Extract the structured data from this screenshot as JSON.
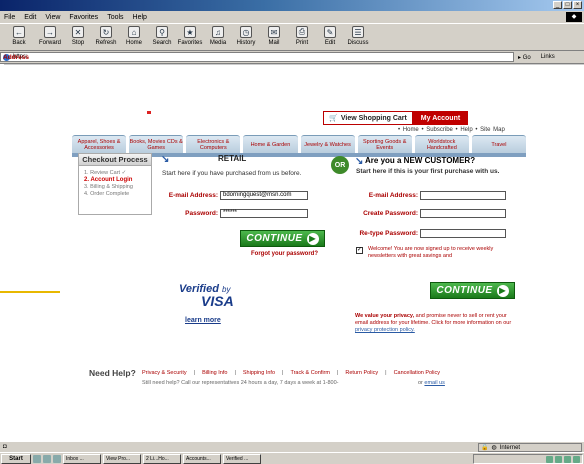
{
  "browser": {
    "menu": [
      "File",
      "Edit",
      "View",
      "Favorites",
      "Tools",
      "Help"
    ],
    "toolbar": [
      "Back",
      "Forward",
      "Stop",
      "Refresh",
      "Home",
      "Search",
      "Favorites",
      "Media",
      "History",
      "Mail",
      "Print",
      "Edit",
      "Discuss"
    ],
    "address_label": "Address",
    "address_value": "https:",
    "go_label": "Go",
    "links_label": "Links",
    "status_zone": "Internet"
  },
  "header": {
    "view_cart": "View Shopping Cart",
    "my_account": "My Account",
    "top_links": "• Home • Subscribe • Help • Site Map"
  },
  "nav": [
    "Apparel, Shoes & Accessories",
    "Books, Movies CDs & Games",
    "Electronics & Computers",
    "Home & Garden",
    "Jewelry & Watches",
    "Sporting Goods & Events",
    "Worldstock Handcrafted",
    "Travel"
  ],
  "process": {
    "title": "Checkout Process",
    "steps": [
      "1. Review Cart ✓",
      "2. Account Login",
      "3. Billing & Shipping",
      "4. Order Complete"
    ]
  },
  "returning": {
    "heading": "RETAIL",
    "subheading": "Start here if you have purchased from us before.",
    "email_label": "E-mail Address:",
    "email_value": "bdorningquest@msn.com",
    "password_label": "Password:",
    "password_value": "******",
    "continue": "CONTINUE",
    "forgot": "Forgot your password?"
  },
  "or_label": "OR",
  "new_customer": {
    "heading": "Are you a NEW CUSTOMER?",
    "subheading": "Start here if this is your first purchase with us.",
    "email_label": "E-mail Address:",
    "create_password_label": "Create Password:",
    "retype_password_label": "Re-type Password:",
    "welcome": "Welcome! You are now signed up to receive weekly newsletters with great savings and",
    "continue": "CONTINUE"
  },
  "verified": {
    "line1": "Verified",
    "by": "by",
    "line2": "VISA",
    "learn_more": "learn more"
  },
  "privacy": {
    "bold": "We value your privacy,",
    "text": " and promise never to sell or rent your email address for your lifetime. Click for more information on our ",
    "link": "privacy protection policy."
  },
  "footer": {
    "need_help": "Need Help?",
    "links": [
      "Privacy & Security",
      "Billing Info",
      "Shipping Info",
      "Track & Confirm",
      "Return Policy",
      "Cancellation Policy"
    ],
    "helpline": "Still need help? Call our representatives 24 hours a day, 7 days a week at 1-800-",
    "or_email": "or",
    "email_link": "email us"
  },
  "taskbar": {
    "start": "Start",
    "tasks": [
      "Inbox ...",
      "View Pro...",
      "2 Li...Ho...",
      "Accounts...",
      "Verified ..."
    ]
  }
}
